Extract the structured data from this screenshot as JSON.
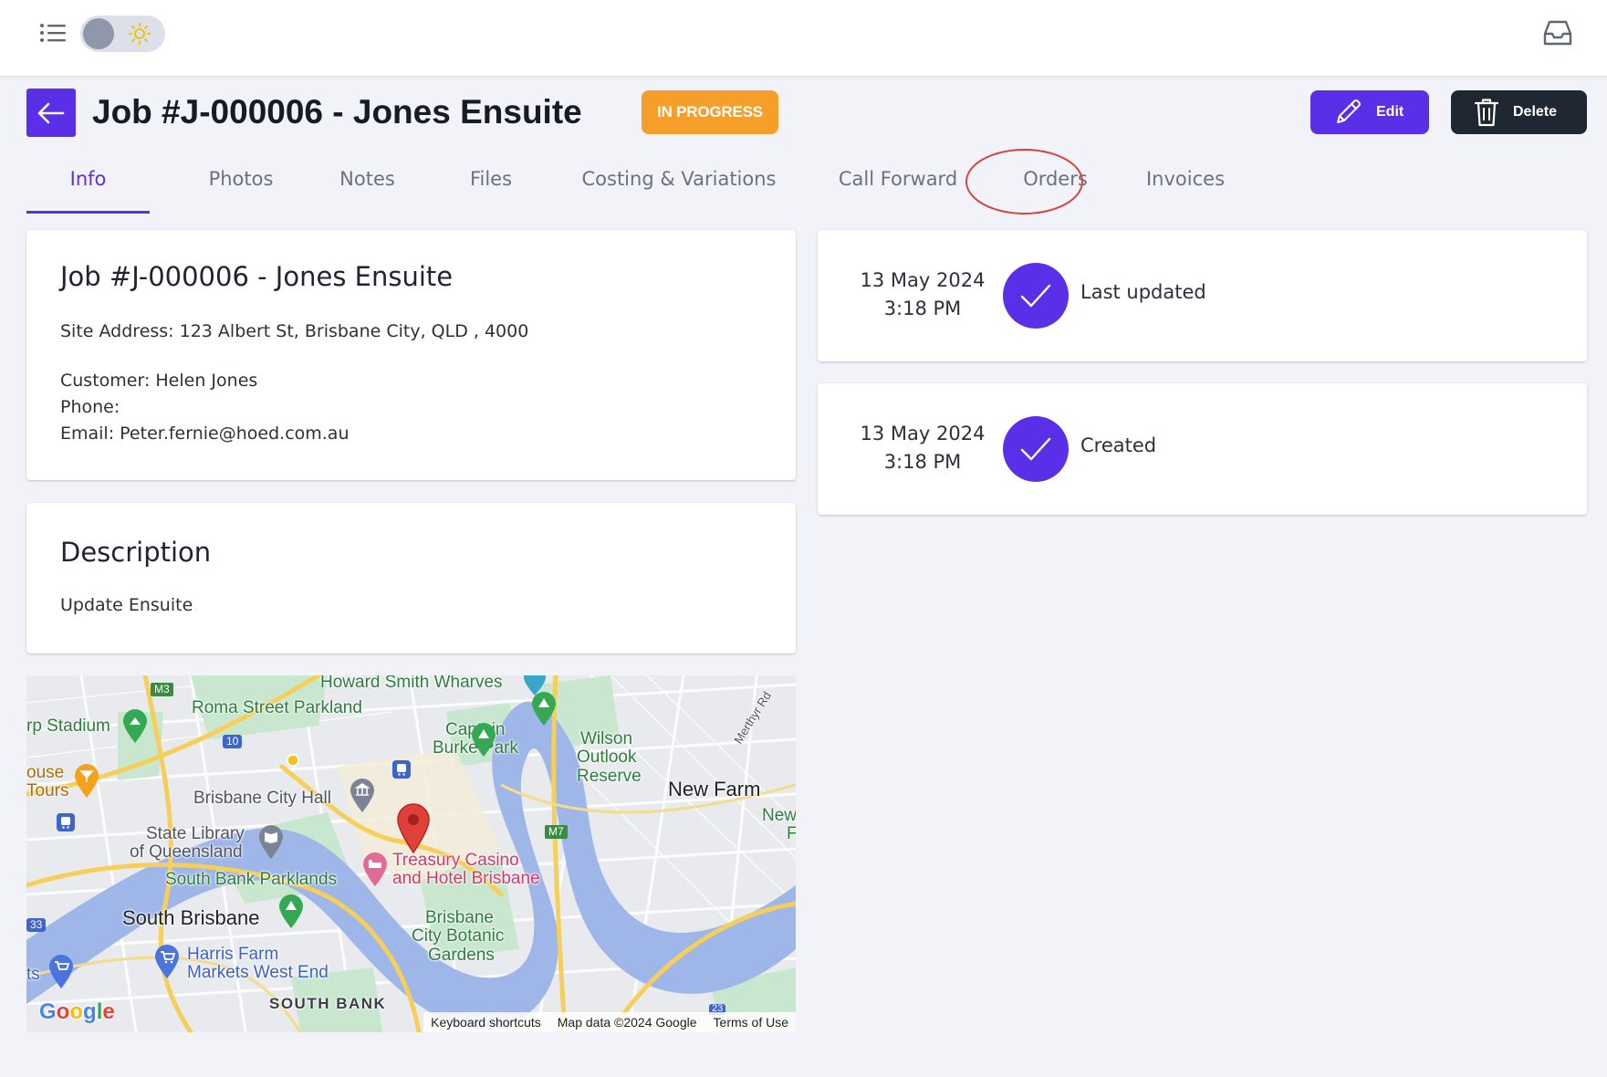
{
  "topbar": {
    "menu_icon": "list-icon",
    "theme_toggle_icon": "sun-icon",
    "inbox_icon": "inbox-icon"
  },
  "header": {
    "back_icon": "arrow-left-icon",
    "title": "Job #J-000006 - Jones Ensuite",
    "status": "IN PROGRESS",
    "status_color": "#f59e2a",
    "edit_label": "Edit",
    "delete_label": "Delete",
    "accent_color": "#5b2ee8"
  },
  "tabs": [
    {
      "label": "Info",
      "active": true
    },
    {
      "label": "Photos"
    },
    {
      "label": "Notes"
    },
    {
      "label": "Files"
    },
    {
      "label": "Costing & Variations"
    },
    {
      "label": "Call Forward"
    },
    {
      "label": "Orders",
      "highlighted": true
    },
    {
      "label": "Invoices"
    }
  ],
  "info": {
    "title": "Job #J-000006 - Jones Ensuite",
    "site_address": "Site Address: 123 Albert St, Brisbane City, QLD , 4000",
    "customer": "Customer: Helen Jones",
    "phone": "Phone:",
    "email": "Email: Peter.fernie@hoed.com.au"
  },
  "description": {
    "title": "Description",
    "text": "Update Ensuite"
  },
  "timeline": [
    {
      "date": "13 May 2024",
      "time": "3:18 PM",
      "label": "Last updated"
    },
    {
      "date": "13 May 2024",
      "time": "3:18 PM",
      "label": "Created"
    }
  ],
  "map": {
    "labels": {
      "howard_smith": "Howard Smith Wharves",
      "roma_street": "Roma Street Parkland",
      "stadium": "rp Stadium",
      "captain_burke_1": "Captain",
      "captain_burke_2": "Burke Park",
      "wilson_1": "Wilson",
      "wilson_2": "Outlook",
      "wilson_3": "Reserve",
      "house_tours_1": "ouse",
      "house_tours_2": "Tours",
      "brisbane_city_hall": "Brisbane City Hall",
      "new_farm": "New Farm",
      "new_f_1": "New",
      "new_f_2": "F",
      "state_library_1": "State Library",
      "state_library_2": "of Queensland",
      "treasury_1": "Treasury Casino",
      "treasury_2": "and Hotel Brisbane",
      "south_bank_parklands": "South Bank Parklands",
      "south_brisbane": "South Brisbane",
      "botanic_1": "Brisbane",
      "botanic_2": "City Botanic",
      "botanic_3": "Gardens",
      "harris_1": "Harris Farm",
      "harris_2": "Markets West End",
      "ts": "ts",
      "south_bank": "SOUTH BANK",
      "merthyr": "Merthyr Rd",
      "road_m3": "M3",
      "road_m7": "M7",
      "road_10": "10",
      "road_33": "33",
      "road_23": "23"
    },
    "google_logo": "Google",
    "footer": {
      "shortcuts": "Keyboard shortcuts",
      "map_data": "Map data ©2024 Google",
      "terms": "Terms of Use"
    }
  }
}
